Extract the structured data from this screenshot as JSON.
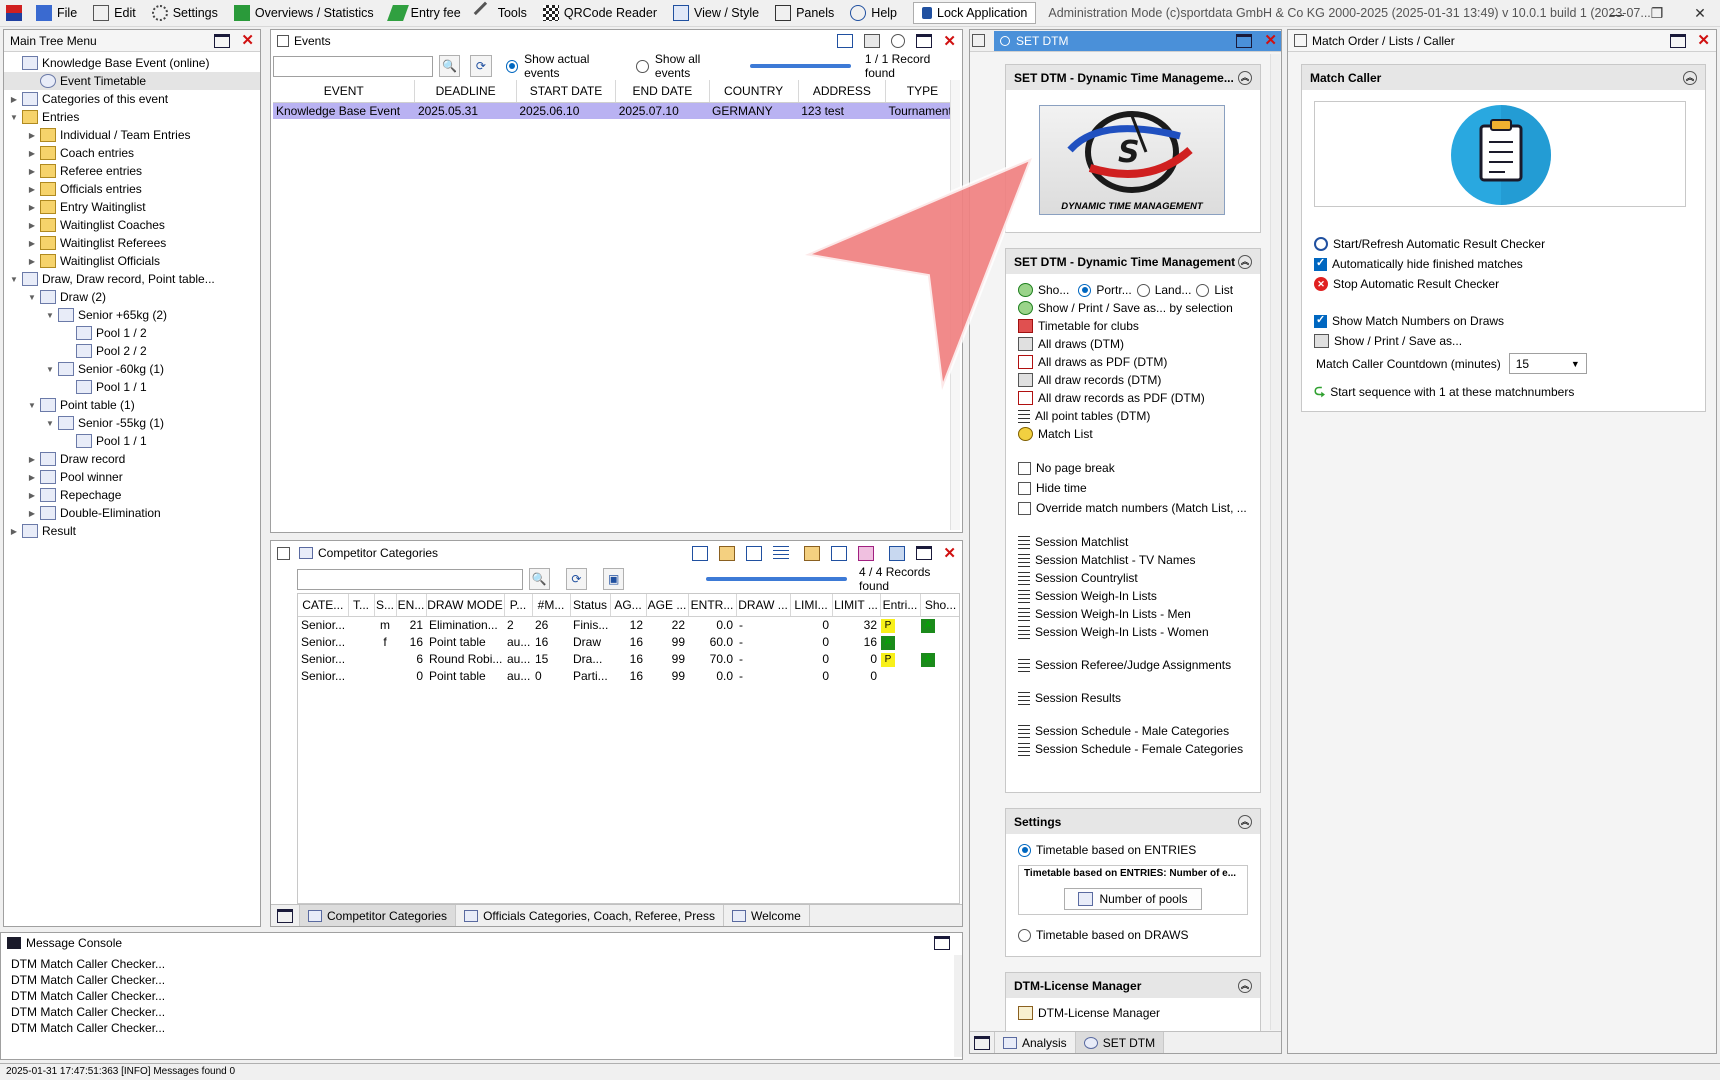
{
  "menu": {
    "items": [
      {
        "label": "File",
        "icon": "file-icon"
      },
      {
        "label": "Edit",
        "icon": "edit-icon"
      },
      {
        "label": "Settings",
        "icon": "gear-icon"
      },
      {
        "label": "Overviews / Statistics",
        "icon": "chart-icon"
      },
      {
        "label": "Entry fee",
        "icon": "money-icon"
      },
      {
        "label": "Tools",
        "icon": "wrench-icon"
      },
      {
        "label": "QRCode Reader",
        "icon": "qrcode-icon"
      },
      {
        "label": "View / Style",
        "icon": "view-icon"
      },
      {
        "label": "Panels",
        "icon": "panels-icon"
      },
      {
        "label": "Help",
        "icon": "help-icon"
      }
    ],
    "lock_label": "Lock Application",
    "admin_text": "Administration Mode (c)sportdata GmbH & Co KG 2000-2025 (2025-01-31 13:49)  v 10.0.1 build 1 (2023-07..."
  },
  "tree": {
    "title": "Main Tree Menu",
    "nodes": [
      {
        "label": "Knowledge Base Event (online)",
        "level": 0,
        "arrow": ""
      },
      {
        "label": "Event Timetable",
        "level": 1,
        "arrow": "",
        "selected": true
      },
      {
        "label": "Categories of this event",
        "level": 0,
        "arrow": "▶"
      },
      {
        "label": "Entries",
        "level": 0,
        "arrow": "▼",
        "folder": true
      },
      {
        "label": "Individual / Team Entries",
        "level": 1,
        "arrow": "▶",
        "folder": true
      },
      {
        "label": "Coach entries",
        "level": 1,
        "arrow": "▶",
        "folder": true
      },
      {
        "label": "Referee entries",
        "level": 1,
        "arrow": "▶",
        "folder": true
      },
      {
        "label": "Officials entries",
        "level": 1,
        "arrow": "▶",
        "folder": true
      },
      {
        "label": "Entry Waitinglist",
        "level": 1,
        "arrow": "▶",
        "folder": true
      },
      {
        "label": "Waitinglist Coaches",
        "level": 1,
        "arrow": "▶",
        "folder": true
      },
      {
        "label": "Waitinglist Referees",
        "level": 1,
        "arrow": "▶",
        "folder": true
      },
      {
        "label": "Waitinglist Officials",
        "level": 1,
        "arrow": "▶",
        "folder": true
      },
      {
        "label": "Draw, Draw record, Point table...",
        "level": 0,
        "arrow": "▼"
      },
      {
        "label": "Draw (2)",
        "level": 1,
        "arrow": "▼"
      },
      {
        "label": "Senior +65kg (2)",
        "level": 2,
        "arrow": "▼"
      },
      {
        "label": "Pool 1 / 2",
        "level": 3,
        "arrow": ""
      },
      {
        "label": "Pool 2 / 2",
        "level": 3,
        "arrow": ""
      },
      {
        "label": "Senior -60kg (1)",
        "level": 2,
        "arrow": "▼"
      },
      {
        "label": "Pool 1 / 1",
        "level": 3,
        "arrow": ""
      },
      {
        "label": "Point table (1)",
        "level": 1,
        "arrow": "▼"
      },
      {
        "label": "Senior -55kg (1)",
        "level": 2,
        "arrow": "▼"
      },
      {
        "label": "Pool 1 / 1",
        "level": 3,
        "arrow": ""
      },
      {
        "label": "Draw record",
        "level": 1,
        "arrow": "▶"
      },
      {
        "label": "Pool winner",
        "level": 1,
        "arrow": "▶"
      },
      {
        "label": "Repechage",
        "level": 1,
        "arrow": "▶"
      },
      {
        "label": "Double-Elimination",
        "level": 1,
        "arrow": "▶"
      },
      {
        "label": "Result",
        "level": 0,
        "arrow": "▶"
      }
    ]
  },
  "events": {
    "title": "Events",
    "show_actual": "Show actual events",
    "show_all": "Show all events",
    "records": "1 / 1 Record found",
    "columns": [
      "EVENT",
      "DEADLINE",
      "START DATE",
      "END DATE",
      "COUNTRY",
      "ADDRESS",
      "TYPE"
    ],
    "rows": [
      [
        "Knowledge Base Event",
        "2025.05.31",
        "2025.06.10",
        "2025.07.10",
        "GERMANY",
        "123 test",
        "Tournament"
      ]
    ]
  },
  "categories": {
    "title": "Competitor Categories",
    "records": "4 / 4 Records found",
    "columns": [
      "CATE...",
      "T...",
      "S...",
      "EN...",
      "DRAW MODE",
      "P...",
      "#M...",
      "Status",
      "AG...",
      "AGE ...",
      "ENTR...",
      "DRAW ...",
      "LIMI...",
      "LIMIT ...",
      "Entri...",
      "Sho..."
    ],
    "rows": [
      [
        "Senior...",
        "",
        "m",
        "21",
        "Elimination...",
        "2",
        "26",
        "Finis...",
        "12",
        "22",
        "0.0",
        "-",
        "0",
        "32",
        "P",
        "A"
      ],
      [
        "Senior...",
        "",
        "f",
        "16",
        "Point table",
        "au...",
        "16",
        "Draw",
        "16",
        "99",
        "60.0",
        "-",
        "0",
        "16",
        "A",
        ""
      ],
      [
        "Senior...",
        "",
        "",
        "6",
        "Round Robi...",
        "au...",
        "15",
        "Dra...",
        "16",
        "99",
        "70.0",
        "-",
        "0",
        "0",
        "P",
        "A"
      ],
      [
        "Senior...",
        "",
        "",
        "0",
        "Point table",
        "au...",
        "0",
        "Parti...",
        "16",
        "99",
        "0.0",
        "-",
        "0",
        "0",
        "",
        ""
      ]
    ],
    "tabs": [
      "Competitor Categories",
      "Officials Categories, Coach, Referee, Press",
      "Welcome"
    ]
  },
  "console": {
    "title": "Message Console",
    "lines": [
      "DTM Match Caller Checker...",
      "DTM Match Caller Checker...",
      "DTM Match Caller Checker...",
      "DTM Match Caller Checker...",
      "DTM Match Caller Checker..."
    ]
  },
  "status": "2025-01-31 17:47:51:363 [INFO] Messages found 0",
  "dtm": {
    "panel_title": "SET DTM",
    "sec1_title": "SET DTM - Dynamic Time Manageme...",
    "logo_text": "DYNAMIC TIME MANAGEMENT",
    "sec2_title": "SET DTM - Dynamic Time Management",
    "orient": {
      "show": "Sho...",
      "portrait": "Portr...",
      "landscape": "Land...",
      "list": "List"
    },
    "items1": [
      {
        "label": "Show / Print / Save as... by selection",
        "icon": "print-selection-icon"
      },
      {
        "label": "Timetable for clubs",
        "icon": "house-icon"
      },
      {
        "label": "All draws (DTM)",
        "icon": "printer-icon"
      },
      {
        "label": "All draws as PDF (DTM)",
        "icon": "pdf-icon"
      },
      {
        "label": "All draw records (DTM)",
        "icon": "printer-icon"
      },
      {
        "label": "All draw records as PDF (DTM)",
        "icon": "pdf-icon"
      },
      {
        "label": "All point tables (DTM)",
        "icon": "list-icon"
      },
      {
        "label": "Match List",
        "icon": "match-list-icon"
      }
    ],
    "checks": [
      "No page break",
      "Hide time",
      "Override match numbers (Match List, ..."
    ],
    "sessions": [
      "Session Matchlist",
      "Session Matchlist - TV Names",
      "Session Countrylist",
      "Session Weigh-In Lists",
      "Session Weigh-In Lists - Men",
      "Session Weigh-In Lists - Women",
      "Session Referee/Judge Assignments",
      "Session Results",
      "Session Schedule - Male Categories",
      "Session Schedule - Female Categories"
    ],
    "settings_title": "Settings",
    "tt_entries": "Timetable based on ENTRIES",
    "tt_entries_group": "Timetable based on ENTRIES: Number of e...",
    "pools_btn": "Number of pools",
    "tt_draws": "Timetable based on DRAWS",
    "license_title": "DTM-License Manager",
    "license_item": "DTM-License Manager",
    "tabs": [
      "Analysis",
      "SET DTM"
    ]
  },
  "match": {
    "panel_title": "Match Order / Lists / Caller",
    "sec_title": "Match Caller",
    "start_refresh": "Start/Refresh Automatic Result Checker",
    "auto_hide": "Automatically hide finished matches",
    "stop": "Stop Automatic Result Checker",
    "show_numbers": "Show Match Numbers on Draws",
    "show_print": "Show / Print / Save as...",
    "countdown_label": "Match Caller Countdown (minutes)",
    "countdown_value": "15",
    "start_sequence": "Start sequence with 1 at these matchnumbers"
  },
  "colors": {
    "accent": "#0067c0",
    "selection": "#b9b2f2",
    "arrow": "#f08080",
    "caller_icon_bg": "#29a8e0"
  }
}
